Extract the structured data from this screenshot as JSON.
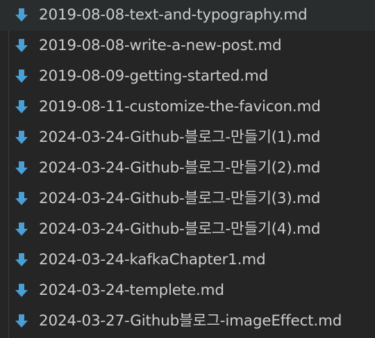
{
  "explorer": {
    "accent_color": "#4a9fd6",
    "text_color": "#cccccc",
    "background": "#252526",
    "files": [
      {
        "name": "2019-08-08-text-and-typography.md",
        "icon": "markdown-download-icon"
      },
      {
        "name": "2019-08-08-write-a-new-post.md",
        "icon": "markdown-download-icon"
      },
      {
        "name": "2019-08-09-getting-started.md",
        "icon": "markdown-download-icon"
      },
      {
        "name": "2019-08-11-customize-the-favicon.md",
        "icon": "markdown-download-icon"
      },
      {
        "name": "2024-03-24-Github-블로그-만들기(1).md",
        "icon": "markdown-download-icon"
      },
      {
        "name": "2024-03-24-Github-블로그-만들기(2).md",
        "icon": "markdown-download-icon"
      },
      {
        "name": "2024-03-24-Github-블로그-만들기(3).md",
        "icon": "markdown-download-icon"
      },
      {
        "name": "2024-03-24-Github-블로그-만들기(4).md",
        "icon": "markdown-download-icon"
      },
      {
        "name": "2024-03-24-kafkaChapter1.md",
        "icon": "markdown-download-icon"
      },
      {
        "name": "2024-03-24-templete.md",
        "icon": "markdown-download-icon"
      },
      {
        "name": "2024-03-27-Github블로그-imageEffect.md",
        "icon": "markdown-download-icon"
      }
    ]
  }
}
